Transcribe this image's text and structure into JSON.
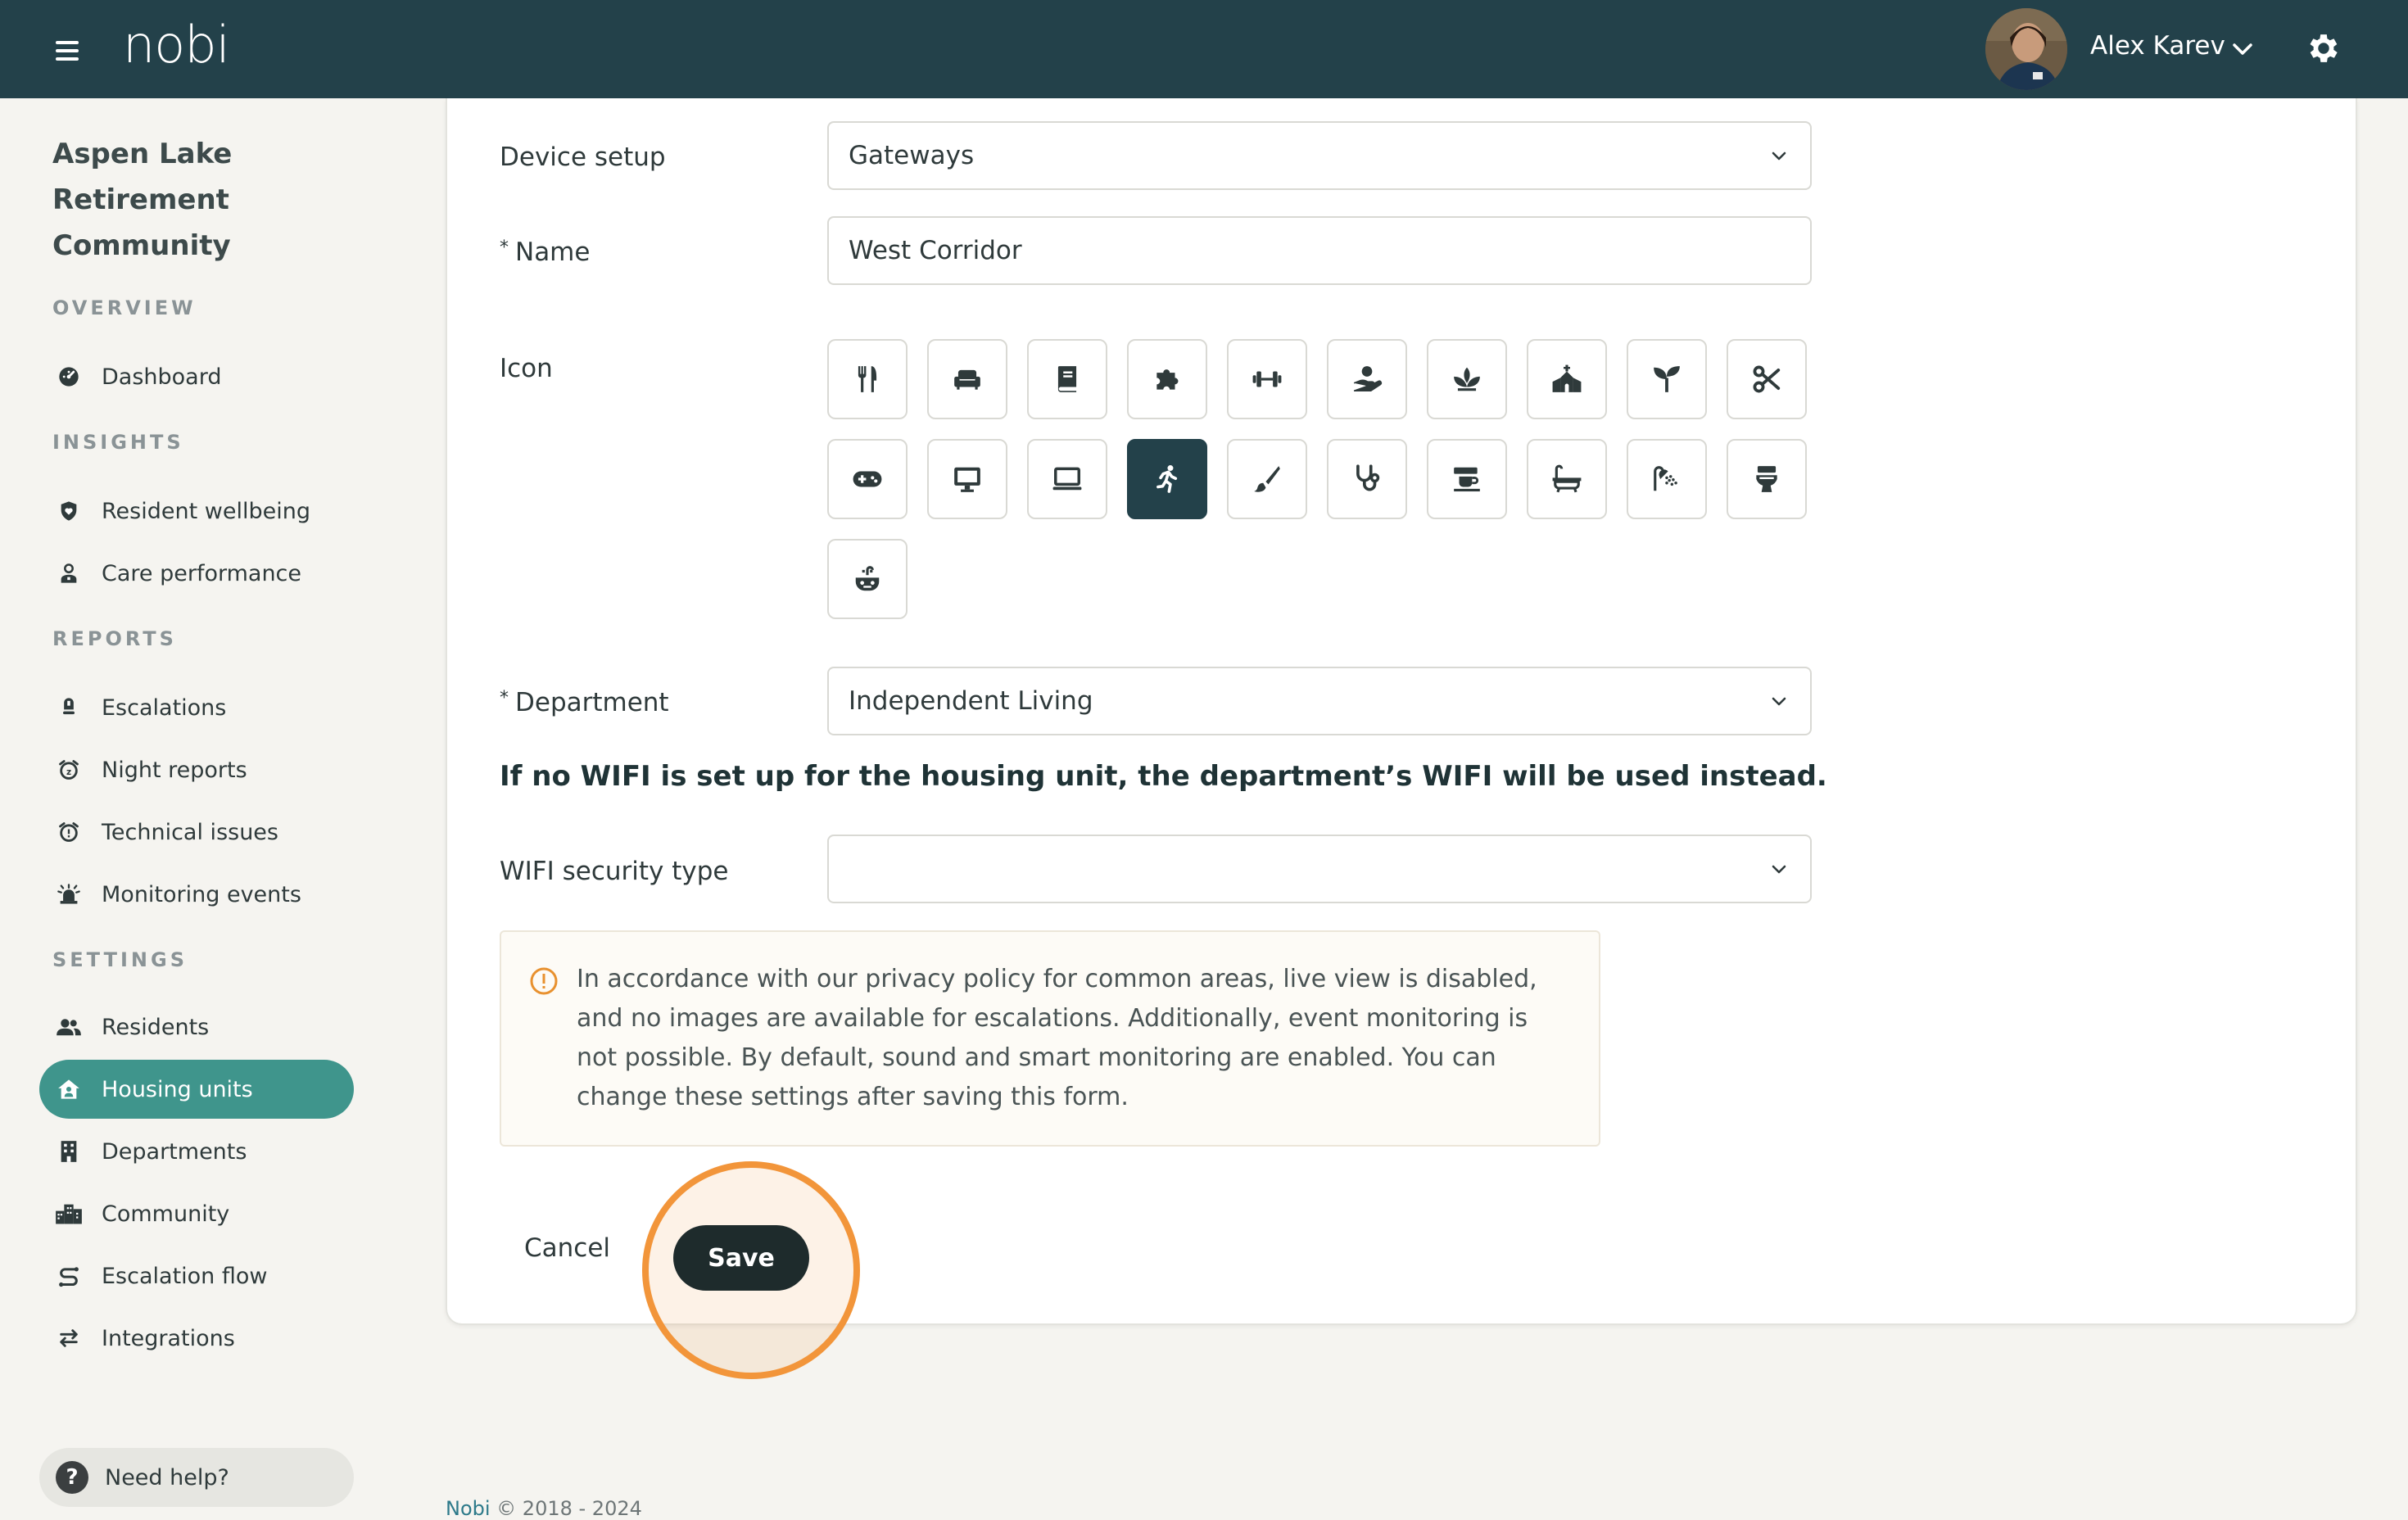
{
  "header": {
    "logo_text": "nobi",
    "user_name": "Alex Karev",
    "icons": [
      "hamburger-menu-icon",
      "chevron-down-icon",
      "gear-icon"
    ]
  },
  "sidebar": {
    "org_name": "Aspen Lake Retirement Community",
    "sections": [
      {
        "title": "OVERVIEW",
        "items": [
          {
            "label": "Dashboard",
            "icon": "dashboard-icon"
          }
        ]
      },
      {
        "title": "INSIGHTS",
        "items": [
          {
            "label": "Resident wellbeing",
            "icon": "shield-heart-icon"
          },
          {
            "label": "Care performance",
            "icon": "caregiver-icon"
          }
        ]
      },
      {
        "title": "REPORTS",
        "items": [
          {
            "label": "Escalations",
            "icon": "alert-icon"
          },
          {
            "label": "Night reports",
            "icon": "alarm-clock-icon"
          },
          {
            "label": "Technical issues",
            "icon": "alarm-warning-icon"
          },
          {
            "label": "Monitoring events",
            "icon": "siren-icon"
          }
        ]
      },
      {
        "title": "SETTINGS",
        "items": [
          {
            "label": "Residents",
            "icon": "people-icon"
          },
          {
            "label": "Housing units",
            "icon": "house-person-icon"
          },
          {
            "label": "Departments",
            "icon": "building-icon"
          },
          {
            "label": "Community",
            "icon": "city-icon"
          },
          {
            "label": "Escalation flow",
            "icon": "route-icon"
          },
          {
            "label": "Integrations",
            "icon": "swap-arrows-icon"
          }
        ]
      }
    ],
    "active_item": "Housing units",
    "help_label": "Need help?"
  },
  "form": {
    "device_setup": {
      "label": "Device setup",
      "value": "Gateways"
    },
    "name": {
      "label": "Name",
      "required_mark": "*",
      "value": "West Corridor"
    },
    "icon": {
      "label": "Icon",
      "options": [
        "cutlery-icon",
        "sofa-icon",
        "book-icon",
        "puzzle-icon",
        "dumbbell-icon",
        "care-hand-icon",
        "lotus-icon",
        "chapel-icon",
        "sprout-icon",
        "scissors-icon",
        "gamepad-icon",
        "desktop-icon",
        "laptop-icon",
        "running-person-icon",
        "paint-brush-icon",
        "stethoscope-icon",
        "coffee-machine-icon",
        "bathtub-icon",
        "shower-icon",
        "toilet-icon",
        "sink-icon"
      ],
      "selected": "running-person-icon"
    },
    "department": {
      "label": "Department",
      "required_mark": "*",
      "value": "Independent Living"
    },
    "wifi_note": "If no WIFI is set up for the housing unit, the department’s WIFI will be used instead.",
    "wifi_security": {
      "label": "WIFI security type",
      "value": ""
    },
    "privacy_notice": "In accordance with our privacy policy for common areas, live view is disabled, and no images are available for escalations. Additionally, event monitoring is not possible. By default, sound and smart monitoring are enabled. You can change these settings after saving this form.",
    "cancel_label": "Cancel",
    "save_label": "Save"
  },
  "footer": {
    "brand": "Nobi",
    "text": " © 2018 - 2024"
  },
  "colors": {
    "topbar": "#23414a",
    "accent": "#3f958c",
    "highlight": "#f2953a",
    "save": "#1e2b2c"
  }
}
